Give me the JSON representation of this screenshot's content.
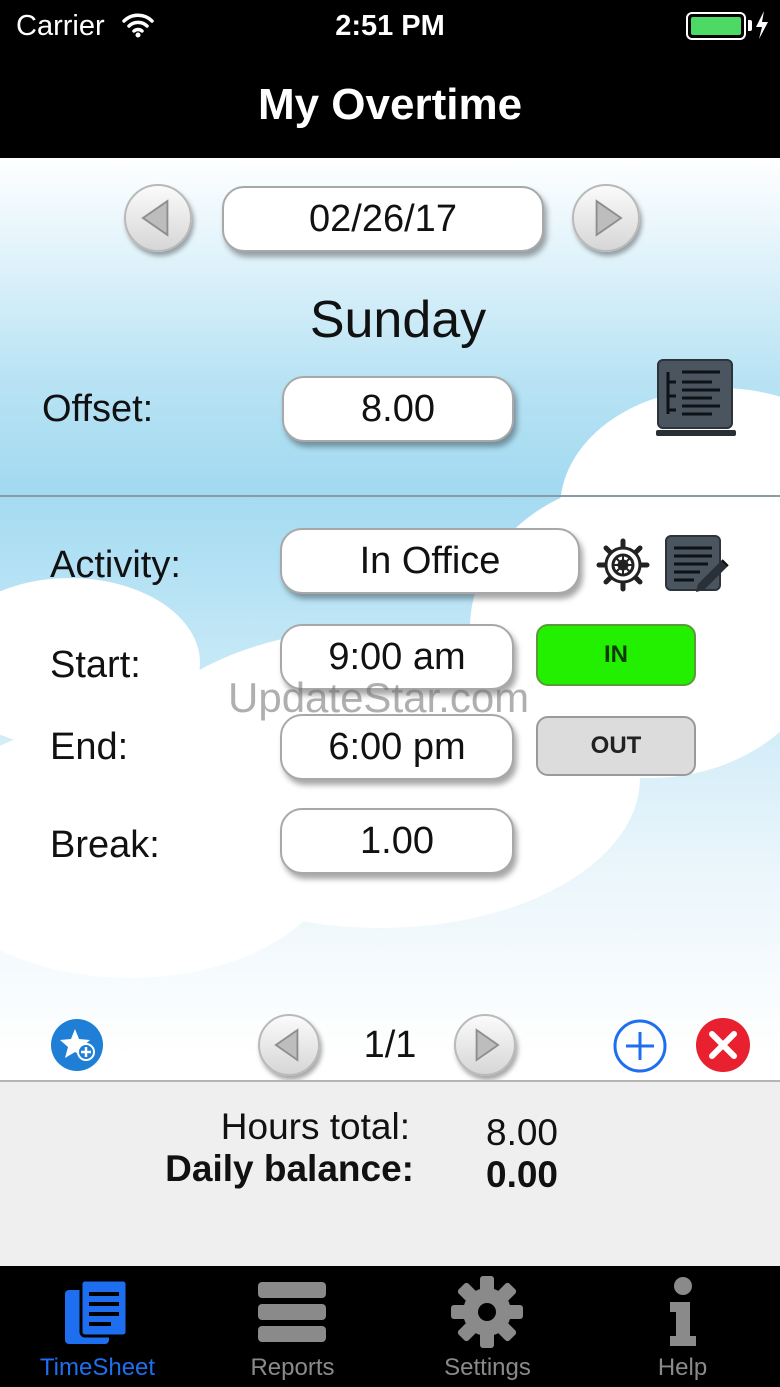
{
  "status_bar": {
    "carrier": "Carrier",
    "time": "2:51 PM"
  },
  "nav": {
    "title": "My Overtime"
  },
  "date_nav": {
    "date": "02/26/17",
    "weekday": "Sunday"
  },
  "offset": {
    "label": "Offset:",
    "value": "8.00"
  },
  "activity": {
    "label": "Activity:",
    "value": "In Office"
  },
  "start": {
    "label": "Start:",
    "value": "9:00 am",
    "button": "IN"
  },
  "end": {
    "label": "End:",
    "value": "6:00 pm",
    "button": "OUT"
  },
  "break_time": {
    "label": "Break:",
    "value": "1.00"
  },
  "watermark": "UpdateStar.com",
  "pager": {
    "text": "1/1"
  },
  "summary": {
    "hours_label": "Hours total:",
    "hours_value": "8.00",
    "balance_label": "Daily balance:",
    "balance_value": "0.00"
  },
  "tabs": [
    {
      "label": "TimeSheet",
      "icon": "timesheet-icon",
      "active": true
    },
    {
      "label": "Reports",
      "icon": "reports-icon",
      "active": false
    },
    {
      "label": "Settings",
      "icon": "settings-icon",
      "active": false
    },
    {
      "label": "Help",
      "icon": "help-icon",
      "active": false
    }
  ],
  "colors": {
    "in_active": "#22f000",
    "accent_blue": "#1e6ef0",
    "delete_red": "#e8202f",
    "favorite_blue": "#1f7fd6"
  }
}
